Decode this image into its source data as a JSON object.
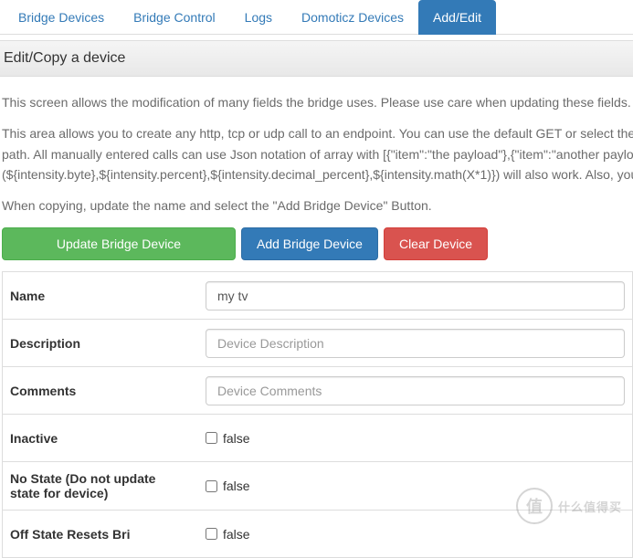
{
  "tabs": [
    {
      "label": "Bridge Devices",
      "active": false
    },
    {
      "label": "Bridge Control",
      "active": false
    },
    {
      "label": "Logs",
      "active": false
    },
    {
      "label": "Domoticz Devices",
      "active": false
    },
    {
      "label": "Add/Edit",
      "active": true
    }
  ],
  "panel": {
    "title": "Edit/Copy a device"
  },
  "descriptions": {
    "line1": "This screen allows the modification of many fields the bridge uses. Please use care when updating these fields.",
    "line2": "This area allows you to create any http, tcp or udp call to an endpoint. You can use the default GET or select the",
    "line3": "path. All manually entered calls can use Json notation of array with [{\"item\":\"the payload\"},{\"item\":\"another payload\"}]",
    "line4": "(${intensity.byte},${intensity.percent},${intensity.decimal_percent},${intensity.math(X*1)}) will also work. Also, you",
    "line5": "When copying, update the name and select the \"Add Bridge Device\" Button."
  },
  "buttons": {
    "update": "Update Bridge Device",
    "add": "Add Bridge Device",
    "clear": "Clear Device"
  },
  "form": {
    "name": {
      "label": "Name",
      "value": "my tv",
      "placeholder": ""
    },
    "description": {
      "label": "Description",
      "value": "",
      "placeholder": "Device Description"
    },
    "comments": {
      "label": "Comments",
      "value": "",
      "placeholder": "Device Comments"
    },
    "inactive": {
      "label": "Inactive",
      "checked": false,
      "text": "false"
    },
    "nostate": {
      "label": "No State (Do not update state for device)",
      "checked": false,
      "text": "false"
    },
    "offstate": {
      "label": "Off State Resets Bri",
      "checked": false,
      "text": "false"
    }
  },
  "watermark": {
    "icon": "值",
    "text": "什么值得买"
  }
}
